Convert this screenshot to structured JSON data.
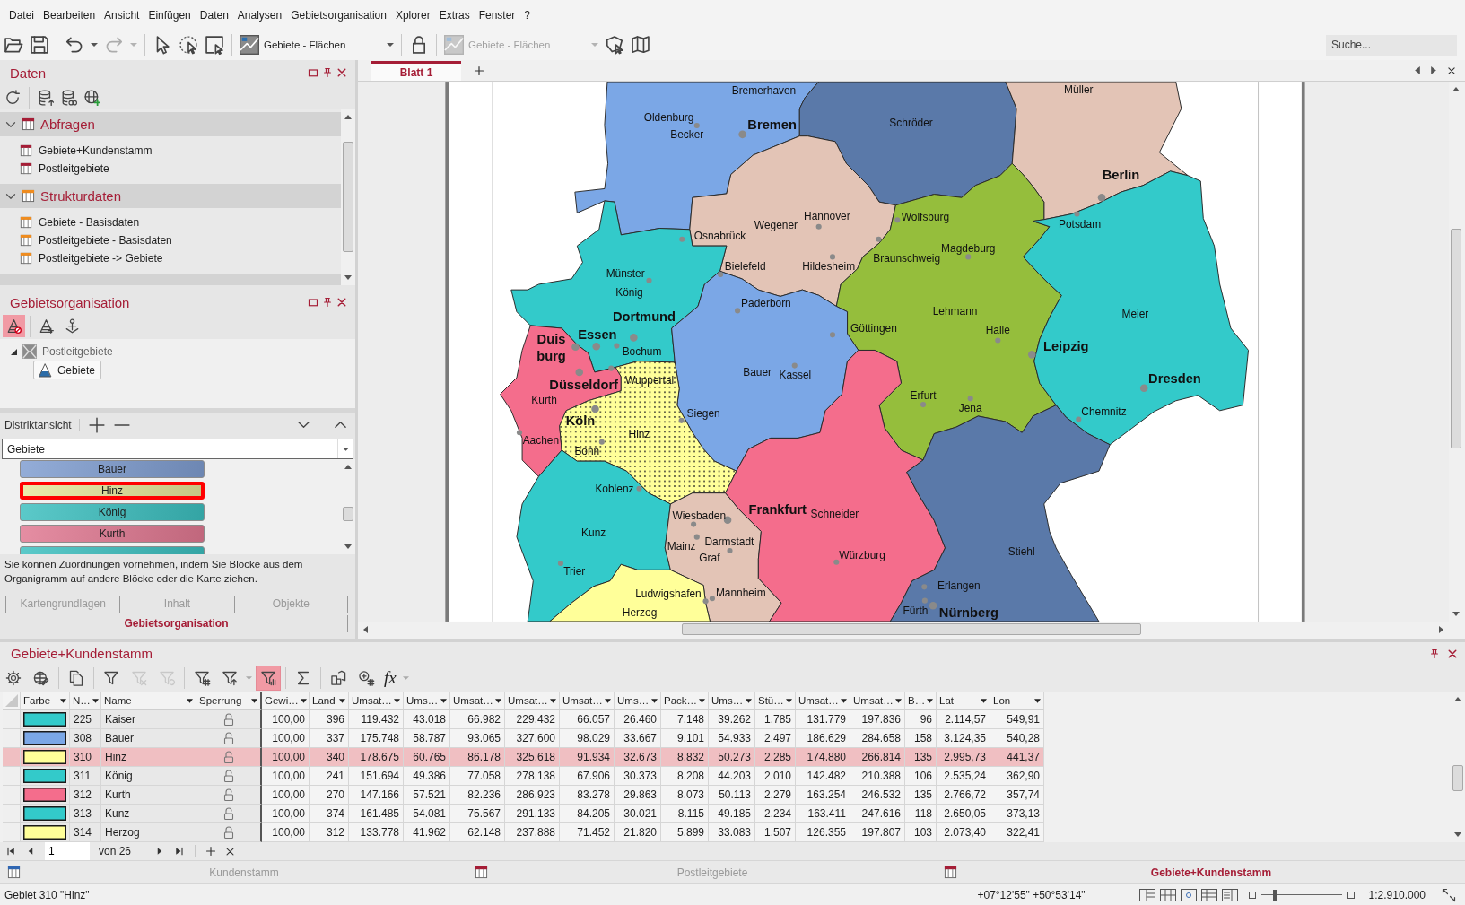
{
  "menu": [
    "Datei",
    "Bearbeiten",
    "Ansicht",
    "Einfügen",
    "Daten",
    "Analysen",
    "Gebietsorganisation",
    "Xplorer",
    "Extras",
    "Fenster",
    "?"
  ],
  "toolbar": [
    {
      "kind": "open",
      "disabled": false
    },
    {
      "kind": "save",
      "disabled": false
    },
    {
      "kind": "undo",
      "disabled": false
    },
    {
      "kind": "redo",
      "disabled": true
    },
    {
      "kind": "select",
      "disabled": false
    },
    {
      "kind": "lasso",
      "disabled": false
    },
    {
      "kind": "rect-select",
      "disabled": false
    },
    {
      "kind": "layer",
      "label": "Gebiete - Flächen",
      "disabled": false
    },
    {
      "kind": "lock",
      "disabled": false
    },
    {
      "kind": "layer",
      "label": "Gebiete - Flächen",
      "disabled": true
    },
    {
      "kind": "map-select",
      "disabled": false
    },
    {
      "kind": "map-book",
      "disabled": false
    }
  ],
  "search": {
    "placeholder": "Suche..."
  },
  "data_panel": {
    "title": "Daten",
    "groups": [
      {
        "name": "Abfragen",
        "kind": "query",
        "expanded": true,
        "items": [
          "Gebiete+Kundenstamm",
          "Postleitgebiete"
        ]
      },
      {
        "name": "Strukturdaten",
        "kind": "structure",
        "expanded": true,
        "items": [
          "Gebiete - Basisdaten",
          "Postleitgebiete - Basisdaten",
          "Postleitgebiete -> Gebiete"
        ]
      }
    ]
  },
  "territory_panel": {
    "title": "Gebietsorganisation",
    "tools": [
      {
        "kind": "remove",
        "selected": true
      },
      {
        "kind": "add",
        "selected": false
      },
      {
        "kind": "hierarchy",
        "selected": false
      }
    ],
    "tree": [
      {
        "label": "Postleitgebiete",
        "expanded": true,
        "selected": false,
        "children": [
          {
            "label": "Gebiete",
            "selected": true
          }
        ]
      }
    ],
    "district_view": {
      "label": "Distriktansicht",
      "dropdown": "Gebiete",
      "blocks": [
        {
          "name": "Bauer",
          "color": "#7f9dd0",
          "selected": false
        },
        {
          "name": "Hinz",
          "color": "#e6e69a",
          "selected": true
        },
        {
          "name": "König",
          "color": "#3cbfbf",
          "selected": false
        },
        {
          "name": "Kurth",
          "color": "#e07891",
          "selected": false
        },
        {
          "color": "#3cbfbf",
          "selected": false
        }
      ]
    },
    "hint": "Sie können Zuordnungen vornehmen, indem Sie Blöcke aus dem Organigramm auf andere Blöcke oder die Karte ziehen."
  },
  "panel_tabs": [
    {
      "label": "Kartengrundlagen",
      "selected": false
    },
    {
      "label": "Inhalt",
      "selected": false
    },
    {
      "label": "Objekte",
      "selected": false
    },
    {
      "label": "Gebietsorganisation",
      "selected": true
    }
  ],
  "map": {
    "tabs": [
      {
        "label": "Blatt 1",
        "selected": true
      }
    ],
    "territories": [
      {
        "name": "Becker",
        "color": "#7ba7e6",
        "selected": false
      },
      {
        "name": "Schröder",
        "color": "#5a79a9",
        "selected": false
      },
      {
        "name": "Müller",
        "color": "#e3c4b6",
        "selected": false
      },
      {
        "name": "Wegener",
        "color": "#e3c4b6",
        "selected": false
      },
      {
        "name": "Lehmann",
        "color": "#95be3c",
        "selected": false
      },
      {
        "name": "Meier",
        "color": "#33caca",
        "selected": false
      },
      {
        "name": "König",
        "color": "#33caca",
        "selected": false
      },
      {
        "name": "Bauer",
        "color": "#7ba7e6",
        "selected": false
      },
      {
        "name": "Kurth",
        "color": "#f46d8c",
        "selected": false
      },
      {
        "name": "Hinz",
        "color": "#ffff99",
        "selected": true
      },
      {
        "name": "Kunz",
        "color": "#33caca",
        "selected": false
      },
      {
        "name": "Graf",
        "color": "#e3c4b6",
        "selected": false
      },
      {
        "name": "Schneider",
        "color": "#f46d8c",
        "selected": false
      },
      {
        "name": "Stiehl",
        "color": "#5a79a9",
        "selected": false
      },
      {
        "name": "Herzog",
        "color": "#ffff99",
        "selected": false
      }
    ],
    "cities": [
      {
        "name": "Bremerhaven",
        "kind": "minor"
      },
      {
        "name": "Oldenburg",
        "kind": "minor"
      },
      {
        "name": "Bremen",
        "kind": "major"
      },
      {
        "name": "Hannover",
        "kind": "minor"
      },
      {
        "name": "Wolfsburg",
        "kind": "minor"
      },
      {
        "name": "Osnabrück",
        "kind": "minor"
      },
      {
        "name": "Berlin",
        "kind": "major"
      },
      {
        "name": "Potsdam",
        "kind": "minor"
      },
      {
        "name": "Braunschweig",
        "kind": "minor"
      },
      {
        "name": "Magdeburg",
        "kind": "minor"
      },
      {
        "name": "Münster",
        "kind": "minor"
      },
      {
        "name": "Bielefeld",
        "kind": "minor"
      },
      {
        "name": "Hildesheim",
        "kind": "minor"
      },
      {
        "name": "Paderborn",
        "kind": "minor"
      },
      {
        "name": "Göttingen",
        "kind": "minor"
      },
      {
        "name": "Halle",
        "kind": "minor"
      },
      {
        "name": "Duis\nburg",
        "kind": "major"
      },
      {
        "name": "Essen",
        "kind": "major"
      },
      {
        "name": "Dortmund",
        "kind": "major"
      },
      {
        "name": "Bochum",
        "kind": "minor"
      },
      {
        "name": "Leipzig",
        "kind": "major"
      },
      {
        "name": "Wuppertal",
        "kind": "minor"
      },
      {
        "name": "Kassel",
        "kind": "minor"
      },
      {
        "name": "Düsseldorf",
        "kind": "major"
      },
      {
        "name": "Dresden",
        "kind": "major"
      },
      {
        "name": "Erfurt",
        "kind": "minor"
      },
      {
        "name": "Siegen",
        "kind": "minor"
      },
      {
        "name": "Chemnitz",
        "kind": "minor"
      },
      {
        "name": "Köln",
        "kind": "major"
      },
      {
        "name": "Jena",
        "kind": "minor"
      },
      {
        "name": "Aachen",
        "kind": "minor"
      },
      {
        "name": "Bonn",
        "kind": "minor"
      },
      {
        "name": "Koblenz",
        "kind": "minor"
      },
      {
        "name": "Frankfurt",
        "kind": "major"
      },
      {
        "name": "Wiesbaden",
        "kind": "minor"
      },
      {
        "name": "Mainz",
        "kind": "minor"
      },
      {
        "name": "Darmstadt",
        "kind": "minor"
      },
      {
        "name": "Würzburg",
        "kind": "minor"
      },
      {
        "name": "Trier",
        "kind": "minor"
      },
      {
        "name": "Erlangen",
        "kind": "minor"
      },
      {
        "name": "Ludwigshafen",
        "kind": "minor"
      },
      {
        "name": "Mannheim",
        "kind": "minor"
      },
      {
        "name": "Fürth",
        "kind": "minor"
      },
      {
        "name": "Nürnberg",
        "kind": "major"
      }
    ]
  },
  "table": {
    "title": "Gebiete+Kundenstamm",
    "tools": [
      {
        "kind": "settings",
        "disabled": false,
        "selected": false
      },
      {
        "kind": "table-globe",
        "disabled": false,
        "selected": false
      },
      {
        "kind": "copy",
        "disabled": false,
        "selected": false
      },
      {
        "kind": "filter",
        "disabled": false,
        "selected": false
      },
      {
        "kind": "filter-remove",
        "disabled": true,
        "selected": false
      },
      {
        "kind": "filter-undo",
        "disabled": true,
        "selected": false
      },
      {
        "kind": "filter-grid",
        "disabled": false,
        "selected": false
      },
      {
        "kind": "filter-sort",
        "disabled": false,
        "selected": false
      },
      {
        "kind": "filter-chart",
        "disabled": false,
        "selected": true
      },
      {
        "kind": "sum",
        "disabled": false,
        "selected": false
      },
      {
        "kind": "map-chart",
        "disabled": false,
        "selected": false
      },
      {
        "kind": "zoom-grid",
        "disabled": false,
        "selected": false
      },
      {
        "kind": "formula",
        "label": "fx",
        "disabled": false,
        "selected": false
      }
    ],
    "columns": [
      "Farbe",
      "N…",
      "Name",
      "Sperrung",
      "Gewi…",
      "Land",
      "Umsat…",
      "Ums…",
      "Umsat…",
      "Umsat…",
      "Umsat…",
      "Ums…",
      "Pack…",
      "Ums…",
      "Stü…",
      "Umsat…",
      "Umsat…",
      "B…",
      "Lat",
      "Lon"
    ],
    "rows": [
      {
        "color": "#33caca",
        "number": "225",
        "name": "Kaiser",
        "locked": false,
        "selected": false,
        "values": [
          "100,00",
          "396",
          "119.432",
          "43.018",
          "66.982",
          "229.432",
          "66.057",
          "26.460",
          "7.148",
          "39.262",
          "1.785",
          "131.779",
          "197.836",
          "96",
          "2.114,57",
          "549,91"
        ]
      },
      {
        "color": "#7ba7e6",
        "number": "308",
        "name": "Bauer",
        "locked": false,
        "selected": false,
        "values": [
          "100,00",
          "337",
          "175.748",
          "58.787",
          "93.065",
          "327.600",
          "98.029",
          "33.667",
          "9.101",
          "54.933",
          "2.497",
          "186.629",
          "284.658",
          "158",
          "3.124,35",
          "540,28"
        ]
      },
      {
        "color": "#ffff99",
        "number": "310",
        "name": "Hinz",
        "locked": false,
        "selected": true,
        "values": [
          "100,00",
          "340",
          "178.675",
          "60.765",
          "86.178",
          "325.618",
          "91.934",
          "32.673",
          "8.832",
          "50.273",
          "2.285",
          "174.880",
          "266.814",
          "135",
          "2.995,73",
          "441,37"
        ]
      },
      {
        "color": "#33caca",
        "number": "311",
        "name": "König",
        "locked": false,
        "selected": false,
        "values": [
          "100,00",
          "241",
          "151.694",
          "49.386",
          "77.058",
          "278.138",
          "67.906",
          "30.373",
          "8.208",
          "44.203",
          "2.010",
          "142.482",
          "210.388",
          "106",
          "2.535,24",
          "362,90"
        ]
      },
      {
        "color": "#f46d8c",
        "number": "312",
        "name": "Kurth",
        "locked": false,
        "selected": false,
        "values": [
          "100,00",
          "270",
          "147.166",
          "57.521",
          "82.236",
          "286.923",
          "83.278",
          "29.863",
          "8.073",
          "50.113",
          "2.279",
          "163.254",
          "246.532",
          "135",
          "2.766,72",
          "357,74"
        ]
      },
      {
        "color": "#33caca",
        "number": "313",
        "name": "Kunz",
        "locked": false,
        "selected": false,
        "values": [
          "100,00",
          "374",
          "161.485",
          "54.081",
          "75.567",
          "291.133",
          "84.205",
          "30.021",
          "8.115",
          "49.185",
          "2.234",
          "163.411",
          "247.616",
          "118",
          "2.650,05",
          "373,13"
        ]
      },
      {
        "color": "#ffff99",
        "number": "314",
        "name": "Herzog",
        "locked": false,
        "selected": false,
        "values": [
          "100,00",
          "312",
          "133.778",
          "41.962",
          "62.148",
          "237.888",
          "71.452",
          "21.820",
          "5.899",
          "33.083",
          "1.507",
          "126.355",
          "197.807",
          "103",
          "2.073,40",
          "322,41"
        ]
      }
    ]
  },
  "pager": {
    "page": "1",
    "total": "von 26"
  },
  "bottom_tabs": [
    {
      "label": "Kundenstamm",
      "kind": "master",
      "selected": false
    },
    {
      "label": "Postleitgebiete",
      "kind": "query",
      "selected": false
    },
    {
      "label": "Gebiete+Kundenstamm",
      "kind": "query",
      "selected": true
    }
  ],
  "status_bar": {
    "text": "Gebiet 310 \"Hinz\"",
    "coordinates": "+07°12'55\" +50°53'14\"",
    "zoom": {
      "level": 0.17
    },
    "scale": "1:2.910.000"
  }
}
